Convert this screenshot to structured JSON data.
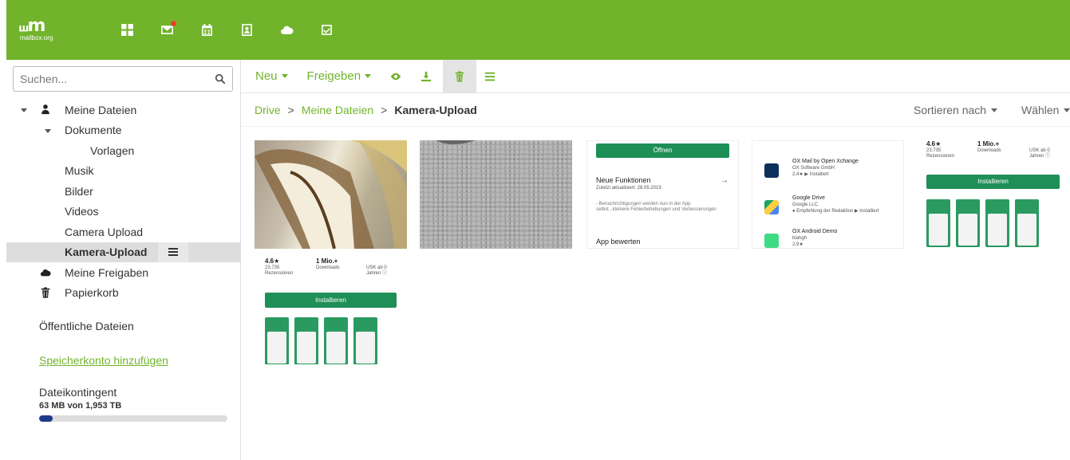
{
  "brand": {
    "logo_mark": "⧢m",
    "logo_text": "mailbox.org"
  },
  "apps": [
    {
      "name": "portal-icon"
    },
    {
      "name": "mail-icon",
      "has_badge": true
    },
    {
      "name": "calendar-icon"
    },
    {
      "name": "contacts-icon"
    },
    {
      "name": "drive-icon"
    },
    {
      "name": "tasks-icon"
    }
  ],
  "search": {
    "placeholder": "Suchen..."
  },
  "tree": {
    "my_files": "Meine Dateien",
    "documents": "Dokumente",
    "templates": "Vorlagen",
    "music": "Musik",
    "pictures": "Bilder",
    "videos": "Videos",
    "camera_upload": "Camera Upload",
    "kamera_upload": "Kamera-Upload",
    "my_shares": "Meine Freigaben",
    "trash": "Papierkorb"
  },
  "public_files": "Öffentliche Dateien",
  "add_storage": "Speicherkonto hinzufügen",
  "quota": {
    "label": "Dateikontingent",
    "value": "63 MB von 1,953 TB",
    "fraction": 0.07
  },
  "toolbar": {
    "new": "Neu",
    "share": "Freigeben"
  },
  "breadcrumb": {
    "drive": "Drive",
    "my_files": "Meine Dateien",
    "current": "Kamera-Upload",
    "sep": ">"
  },
  "sort": "Sortieren nach",
  "choose": "Wählen",
  "thumb3": {
    "open": "Öffnen",
    "new_features": "Neue Funktionen",
    "updated": "Zuletzt aktualisiert: 28.05.2019",
    "notes": "- Benachrichtigungen werden nun in der App selbst...kleinere Fehlerbehebungen und Verbesserungen",
    "rate": "App bewerten",
    "arrow": "→"
  },
  "thumb4": {
    "app1_title": "OX Mail by Open Xchange",
    "app1_dev": "OX Software GmbH",
    "app1_meta": "2,4★  ▶ Installiert",
    "app2_title": "Google Drive",
    "app2_dev": "Google LLC",
    "app2_meta": "● Empfehlung der Redaktion  ▶ Installiert",
    "app3_title": "OX Android Demo",
    "app3_dev": "biahgh",
    "app3_meta": "2,9★"
  },
  "thumb5": {
    "rating": "4.6★",
    "reviews": "23.735 Rezensionen",
    "downloads_value": "1 Mio.+",
    "downloads": "Downloads",
    "age": "USK ab 0 Jahren ⓘ",
    "install": "Installieren"
  },
  "thumb6": {
    "rating": "4.6★",
    "reviews": "23.735 Rezensionen",
    "downloads_value": "1 Mio.+",
    "downloads": "Downloads",
    "age": "USK ab 0 Jahren ⓘ",
    "install": "Installieren"
  }
}
